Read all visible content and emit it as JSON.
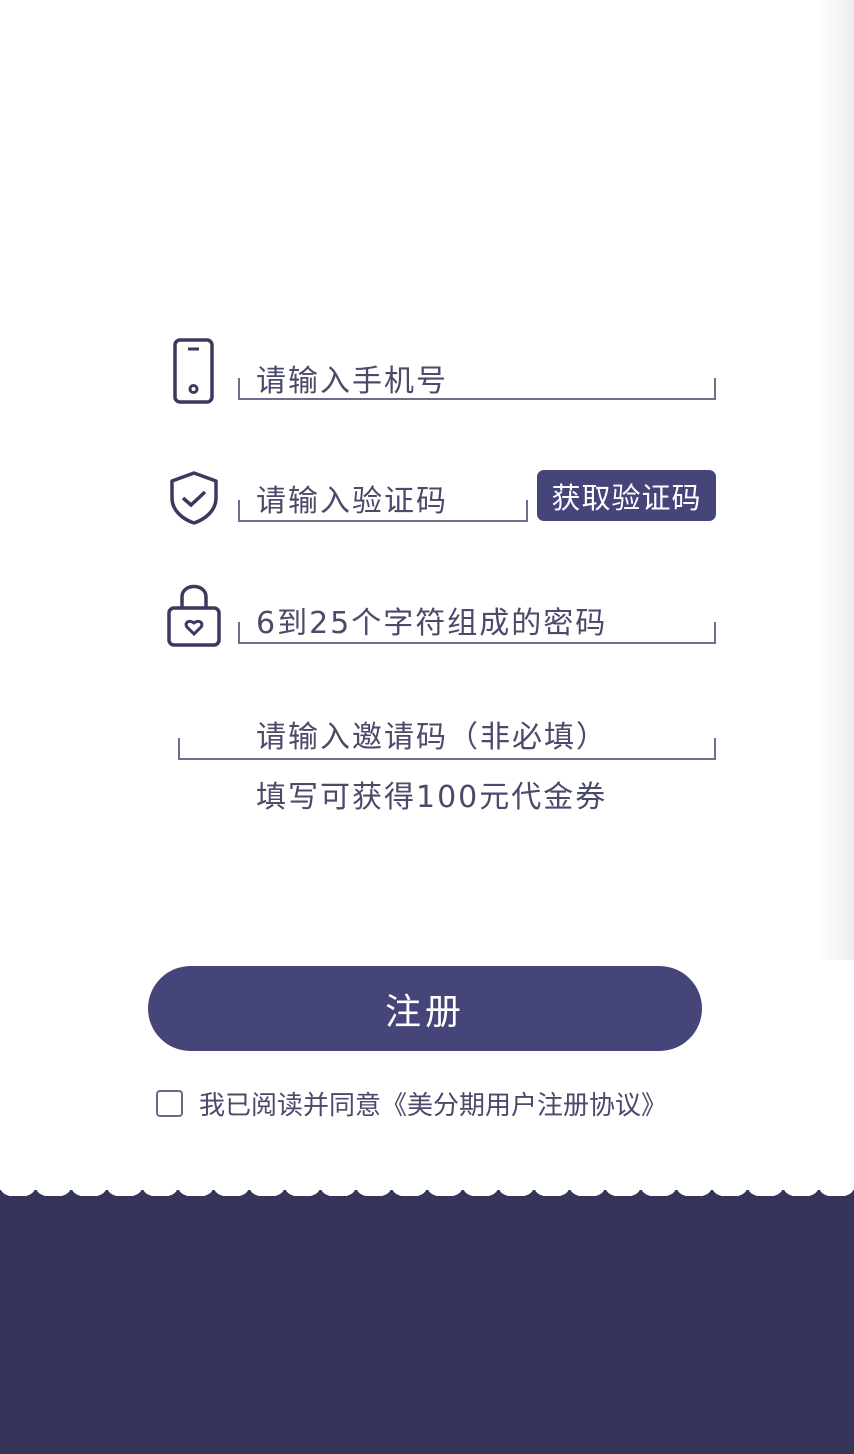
{
  "form": {
    "phone_placeholder": "请输入手机号",
    "code_placeholder": "请输入验证码",
    "get_code_label": "获取验证码",
    "password_placeholder": "6到25个字符组成的密码",
    "invite_placeholder": "请输入邀请码（非必填）",
    "invite_note": "填写可获得100元代金券"
  },
  "register_label": "注册",
  "agreement": {
    "checked": false,
    "text": "我已阅读并同意《美分期用户注册协议》"
  },
  "colors": {
    "primary": "#45457a",
    "footer": "#35355a"
  }
}
